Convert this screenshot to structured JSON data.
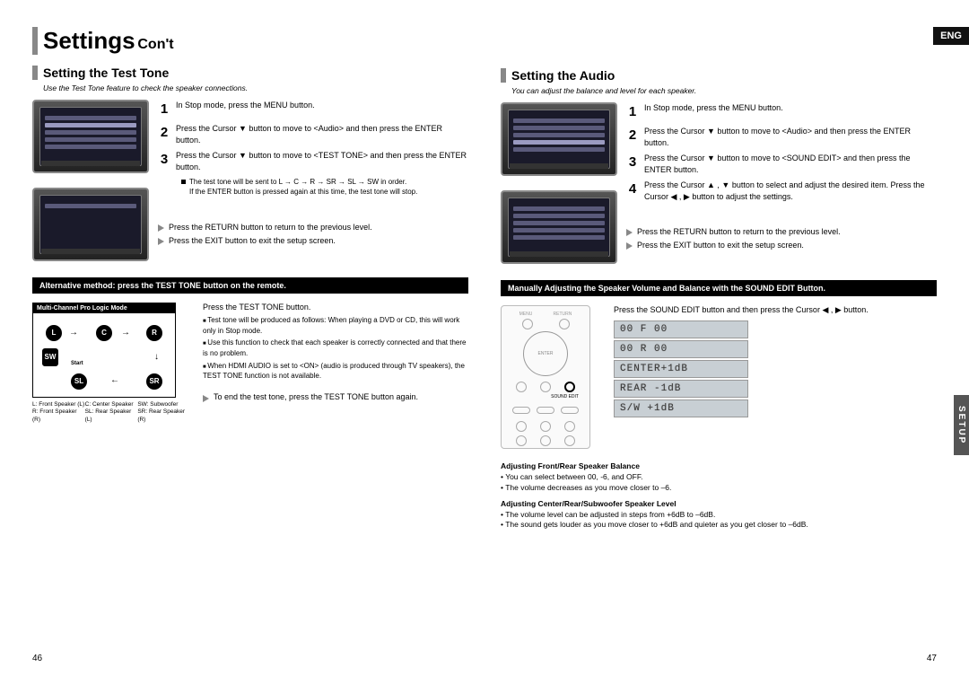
{
  "header": {
    "title_main": "Settings",
    "title_sub": "Con't",
    "lang_tab": "ENG",
    "side_tab": "SETUP"
  },
  "left": {
    "section_title": "Setting the Test Tone",
    "intro": "Use the Test Tone feature to check the speaker connections.",
    "steps": [
      {
        "n": "1",
        "text": "In Stop mode, press the MENU button."
      },
      {
        "n": "2",
        "text": "Press the Cursor ▼ button to move to <Audio> and then press the ENTER button."
      },
      {
        "n": "3",
        "text": "Press the Cursor ▼ button to move to <TEST TONE> and then press the ENTER button."
      }
    ],
    "note1": "The test tone will be sent to L → C → R → SR → SL → SW in order.",
    "note2": "If the ENTER button is pressed again at this time, the test tone will stop.",
    "bullets": [
      "Press the RETURN button to return to the previous level.",
      "Press the EXIT button to exit the setup screen."
    ],
    "band": "Alternative method: press the TEST TONE button on the remote.",
    "diagram_label": "Multi-Channel Pro Logic Mode",
    "speakers": [
      "L",
      "C",
      "R",
      "SW",
      "SL",
      "SR"
    ],
    "start_label": "Start",
    "legend": {
      "l": "L: Front Speaker (L)",
      "c": "C: Center Speaker",
      "sw": "SW: Subwoofer",
      "r": "R: Front Speaker (R)",
      "sl": "SL: Rear Speaker (L)",
      "sr": "SR: Rear Speaker (R)"
    },
    "press_tt": "Press the TEST TONE button.",
    "tt_notes": [
      "Test tone will be produced as follows: When playing a DVD or CD, this will work only in Stop mode.",
      "Use this function to check that each speaker is correctly connected and that there is no problem.",
      "When HDMI AUDIO is set to <ON> (audio is produced through TV speakers), the TEST TONE function is not available."
    ],
    "end_tt": "To end the test tone, press the TEST TONE button again.",
    "page_num": "46"
  },
  "right": {
    "section_title": "Setting the Audio",
    "intro": "You can adjust the balance and level for each speaker.",
    "steps": [
      {
        "n": "1",
        "text": "In Stop mode, press the MENU button."
      },
      {
        "n": "2",
        "text": "Press the Cursor ▼ button to move to <Audio> and then press the ENTER button."
      },
      {
        "n": "3",
        "text": "Press the Cursor ▼ button to move to <SOUND EDIT> and then press the ENTER button."
      },
      {
        "n": "4",
        "text": "Press the Cursor ▲ , ▼ button to select and adjust the desired item. Press the Cursor ◀ , ▶ button to adjust the settings."
      }
    ],
    "bullets": [
      "Press the RETURN button to return to the previous level.",
      "Press the EXIT button to exit the setup screen."
    ],
    "band": "Manually Adjusting the Speaker Volume and Balance with the SOUND EDIT Button.",
    "se_line": "Press the SOUND EDIT button and then press the Cursor ◀ , ▶ button.",
    "lcd": [
      "00 F   00",
      "00 R   00",
      "CENTER+1dB",
      "REAR  -1dB",
      "S/W   +1dB"
    ],
    "adj_fr_title": "Adjusting Front/Rear Speaker Balance",
    "adj_fr_lines": [
      "You can select between 00, -6, and OFF.",
      "The volume decreases as you move closer to –6."
    ],
    "adj_crs_title": "Adjusting Center/Rear/Subwoofer Speaker Level",
    "adj_crs_lines": [
      "The volume level can be adjusted in steps from +6dB to –6dB.",
      "The sound gets louder as you move closer to +6dB and quieter as you get closer to –6dB."
    ],
    "page_num": "47"
  }
}
